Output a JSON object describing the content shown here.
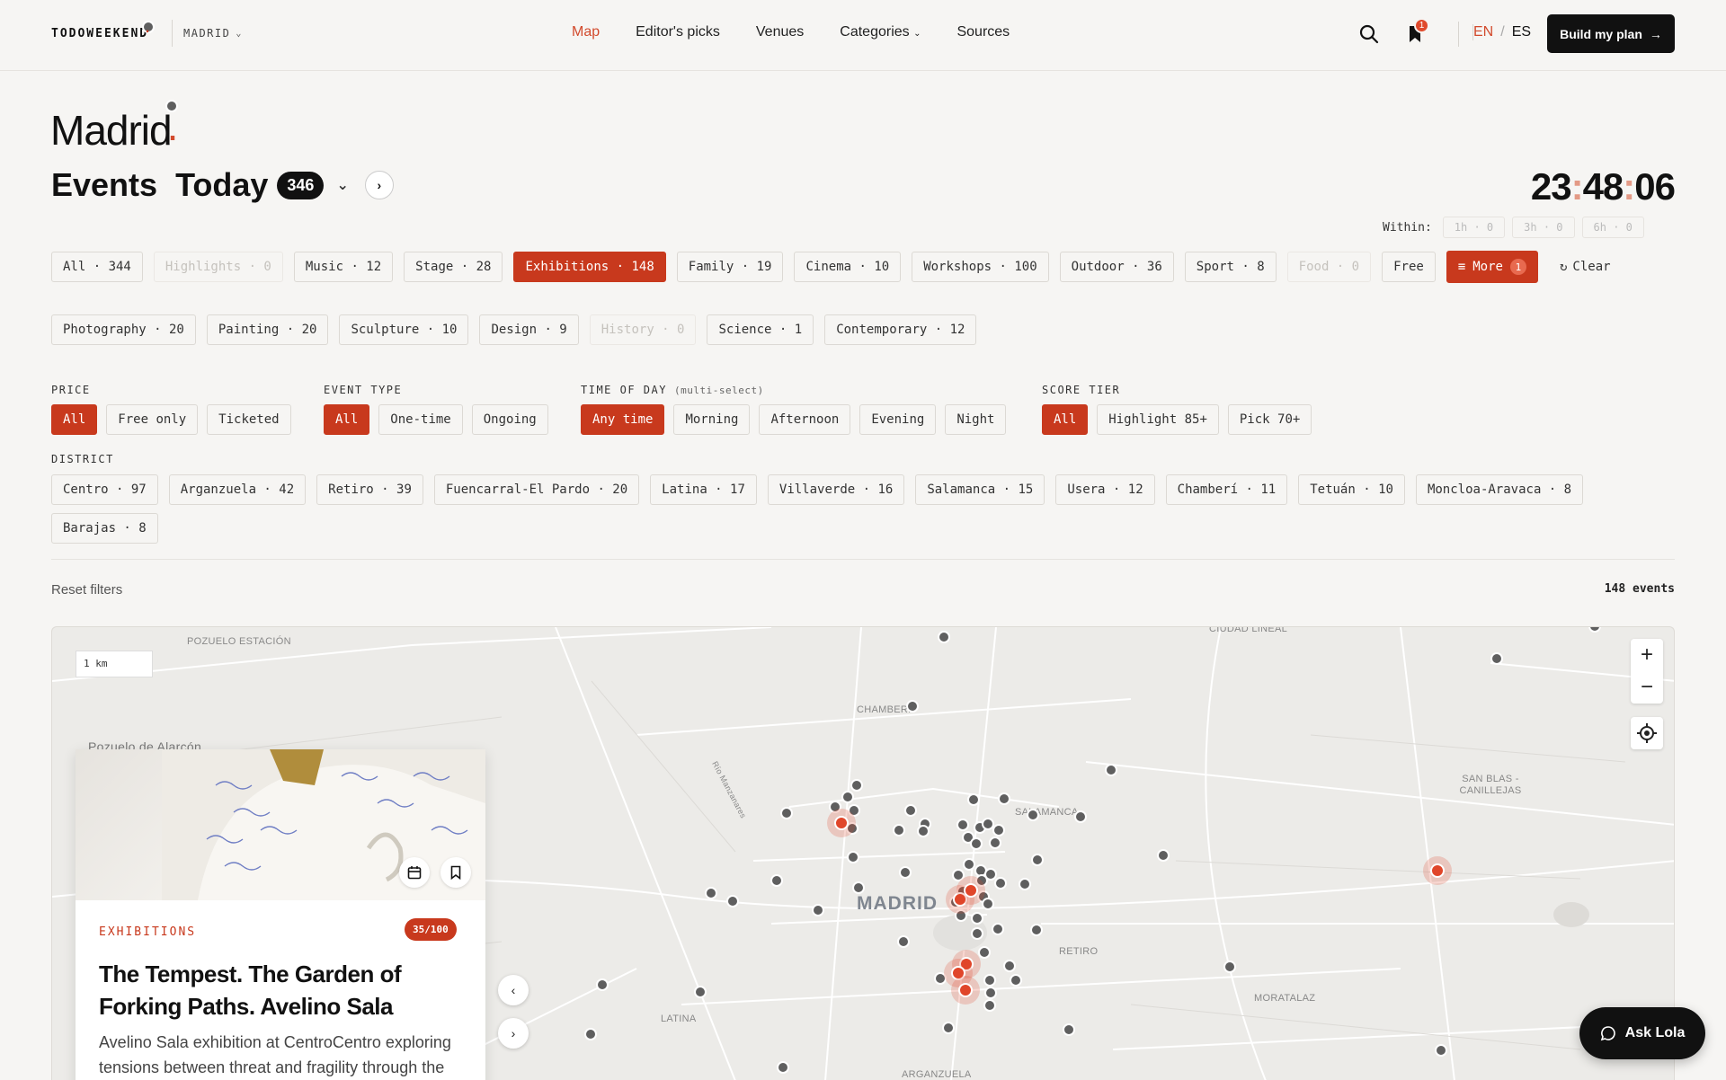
{
  "header": {
    "brand": "TODOWEEKEND",
    "brand_dot": ".",
    "city": "MADRID",
    "nav": [
      "Map",
      "Editor's picks",
      "Venues",
      "Categories",
      "Sources"
    ],
    "bookmark_count": "1",
    "lang_en": "EN",
    "lang_sep": "/",
    "lang_es": "ES",
    "cta": "Build my plan"
  },
  "title": {
    "city": "Madrid",
    "dot": ".",
    "events": "Events",
    "today": "Today",
    "count": "346"
  },
  "clock": {
    "h": "23",
    "m": "48",
    "s": "06",
    "colon": ":"
  },
  "within": {
    "label": "Within:",
    "options": [
      "1h · 0",
      "3h · 0",
      "6h · 0"
    ]
  },
  "categories": [
    "All · 344",
    "Highlights · 0",
    "Music · 12",
    "Stage · 28",
    "Exhibitions · 148",
    "Family · 19",
    "Cinema · 10",
    "Workshops · 100",
    "Outdoor · 36",
    "Sport · 8",
    "Food · 0",
    "Free"
  ],
  "more": {
    "label": "More",
    "count": "1"
  },
  "clear": "Clear",
  "subcategories": [
    "Photography · 20",
    "Painting · 20",
    "Sculpture · 10",
    "Design · 9",
    "History · 0",
    "Science · 1",
    "Contemporary · 12"
  ],
  "filters": {
    "price": {
      "label": "PRICE",
      "options": [
        "All",
        "Free only",
        "Ticketed"
      ]
    },
    "event_type": {
      "label": "EVENT TYPE",
      "options": [
        "All",
        "One-time",
        "Ongoing"
      ]
    },
    "time_of_day": {
      "label": "TIME OF DAY",
      "note": "(multi-select)",
      "options": [
        "Any time",
        "Morning",
        "Afternoon",
        "Evening",
        "Night"
      ]
    },
    "score_tier": {
      "label": "SCORE TIER",
      "options": [
        "All",
        "Highlight 85+",
        "Pick 70+"
      ]
    },
    "district": {
      "label": "DISTRICT",
      "options": [
        "Centro · 97",
        "Arganzuela · 42",
        "Retiro · 39",
        "Fuencarral-El Pardo · 20",
        "Latina · 17",
        "Villaverde · 16",
        "Salamanca · 15",
        "Usera · 12",
        "Chamberí · 11",
        "Tetuán · 10",
        "Moncloa-Aravaca · 8",
        "Barajas · 8"
      ]
    }
  },
  "reset": "Reset filters",
  "events_count": "148 events",
  "map": {
    "scale": "1 km",
    "labels": [
      "POZUELO ESTACIÓN",
      "Pozuelo de Alarcón",
      "CHAMBERÍ",
      "SALAMANCA",
      "MADRID",
      "RETIRO",
      "LATINA",
      "ARGANZUELA",
      "MORATALAZ",
      "SAN BLAS - CANILLEJAS",
      "CIUDAD LINEAL",
      "Río Manzanares"
    ]
  },
  "card": {
    "category": "EXHIBITIONS",
    "score": "35/100",
    "title": "The Tempest. The Garden of Forking Paths. Avelino Sala",
    "description": "Avelino Sala exhibition at CentroCentro exploring tensions between threat and fragility through the sculpture and installation works"
  },
  "ask": "Ask Lola",
  "colors": {
    "accent": "#c8391d",
    "dark": "#111111",
    "bg": "#f6f5f3"
  }
}
